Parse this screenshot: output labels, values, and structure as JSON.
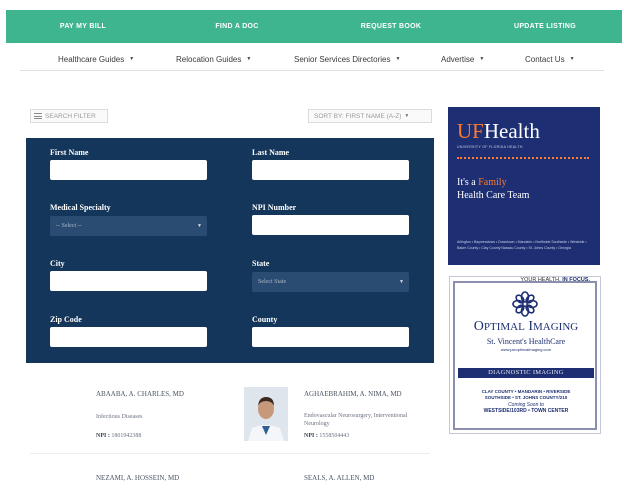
{
  "topbar": {
    "links": [
      "PAY MY BILL",
      "FIND A DOC",
      "REQUEST BOOK",
      "UPDATE LISTING"
    ]
  },
  "nav": {
    "items": [
      "Healthcare Guides",
      "Relocation Guides",
      "Senior Services Directories",
      "Advertise",
      "Contact Us"
    ]
  },
  "filters": {
    "search_filters_label": "SEARCH FILTER",
    "sort_label": "SORT BY: FIRST NAME (A-Z)"
  },
  "form": {
    "first_name_label": "First Name",
    "last_name_label": "Last Name",
    "specialty_label": "Medical Specialty",
    "specialty_value": "-- Select --",
    "npi_label": "NPI Number",
    "city_label": "City",
    "state_label": "State",
    "state_value": "Select State",
    "zip_label": "Zip Code",
    "county_label": "County"
  },
  "ads": {
    "uf": {
      "logo_prefix": "UF",
      "logo_main": "Health",
      "subtitle": "UNIVERSITY OF FLORIDA HEALTH",
      "tagline_a": "It's a",
      "tagline_family": "Family",
      "tagline_b": "Health Care Team",
      "locations": "Arlington • Baymeadows • Downtown • Mandarin • Northside Southside • Westside • Baker County • Clay County Nassau County • St. Johns County • Georgia"
    },
    "optimal": {
      "header_prefix": "YOUR HEALTH.",
      "header_bold": "IN FOCUS.",
      "name_a": "O",
      "name_b": "PTIMAL",
      "name_c": "I",
      "name_d": "MAGING",
      "subtitle": "St. Vincent's HealthCare",
      "website": "www.jaxoptimalimaging.com",
      "diagnostic": "DIAGNOSTIC IMAGING",
      "areas_line1": "CLAY COUNTY • MANDARIN • RIVERSIDE",
      "areas_line2": "SOUTHSIDE • ST. JOHNS COUNTY/210",
      "coming_soon": "Coming Soon to",
      "westside": "WESTSIDE/103RD • TOWN CENTER"
    }
  },
  "doctors": [
    {
      "name": "ABAABA, A. CHARLES, MD",
      "specialty": "Infectious Diseases",
      "npi_label": "NPI :",
      "npi": "1801942388"
    },
    {
      "name": "AGHAEBRAHIM, A. NIMA, MD",
      "specialty": "Endovascular Neurosurgery, Interventional Neurology",
      "npi_label": "NPI :",
      "npi": "1558504443"
    },
    {
      "name": "NEZAMI, A. HOSSEIN, MD"
    },
    {
      "name": "SEALS, A. ALLEN, MD"
    }
  ]
}
